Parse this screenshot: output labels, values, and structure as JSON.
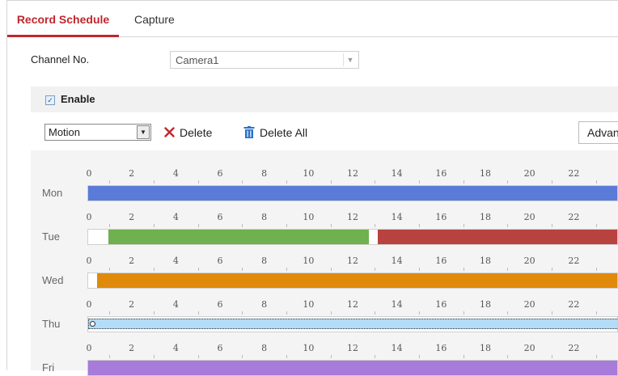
{
  "tabs": [
    {
      "label": "Record Schedule",
      "active": true
    },
    {
      "label": "Capture",
      "active": false
    }
  ],
  "channel": {
    "label": "Channel No.",
    "value": "Camera1"
  },
  "enable": {
    "label": "Enable",
    "checked": true
  },
  "toolbar": {
    "record_type": "Motion",
    "delete_label": "Delete",
    "delete_all_label": "Delete All",
    "advanced_label": "Advan"
  },
  "colors": {
    "accent": "#c0272d",
    "continuous": "#5b7bd9",
    "motion": "#6fb04f",
    "alarm": "#b8423f",
    "motion_or_alarm": "#e08a0b",
    "event": "#b4dcf7",
    "other": "#a67bd9"
  },
  "timeline_ticks": [
    "0",
    "2",
    "4",
    "6",
    "8",
    "10",
    "12",
    "14",
    "16",
    "18",
    "20",
    "22"
  ],
  "days": [
    {
      "label": "Mon",
      "segments": [
        {
          "start": 0,
          "end": 24,
          "color": "#5b7bd9"
        }
      ]
    },
    {
      "label": "Tue",
      "segments": [
        {
          "start": 0.9,
          "end": 12.7,
          "color": "#6fb04f"
        },
        {
          "start": 13.1,
          "end": 24,
          "color": "#b8423f"
        }
      ]
    },
    {
      "label": "Wed",
      "segments": [
        {
          "start": 0.4,
          "end": 24,
          "color": "#e08a0b"
        }
      ]
    },
    {
      "label": "Thu",
      "segments": [
        {
          "start": 0,
          "end": 24,
          "color": "#b4dcf7",
          "selected": true
        }
      ]
    },
    {
      "label": "Fri",
      "segments": [
        {
          "start": 0,
          "end": 24,
          "color": "#a67bd9"
        }
      ]
    }
  ]
}
